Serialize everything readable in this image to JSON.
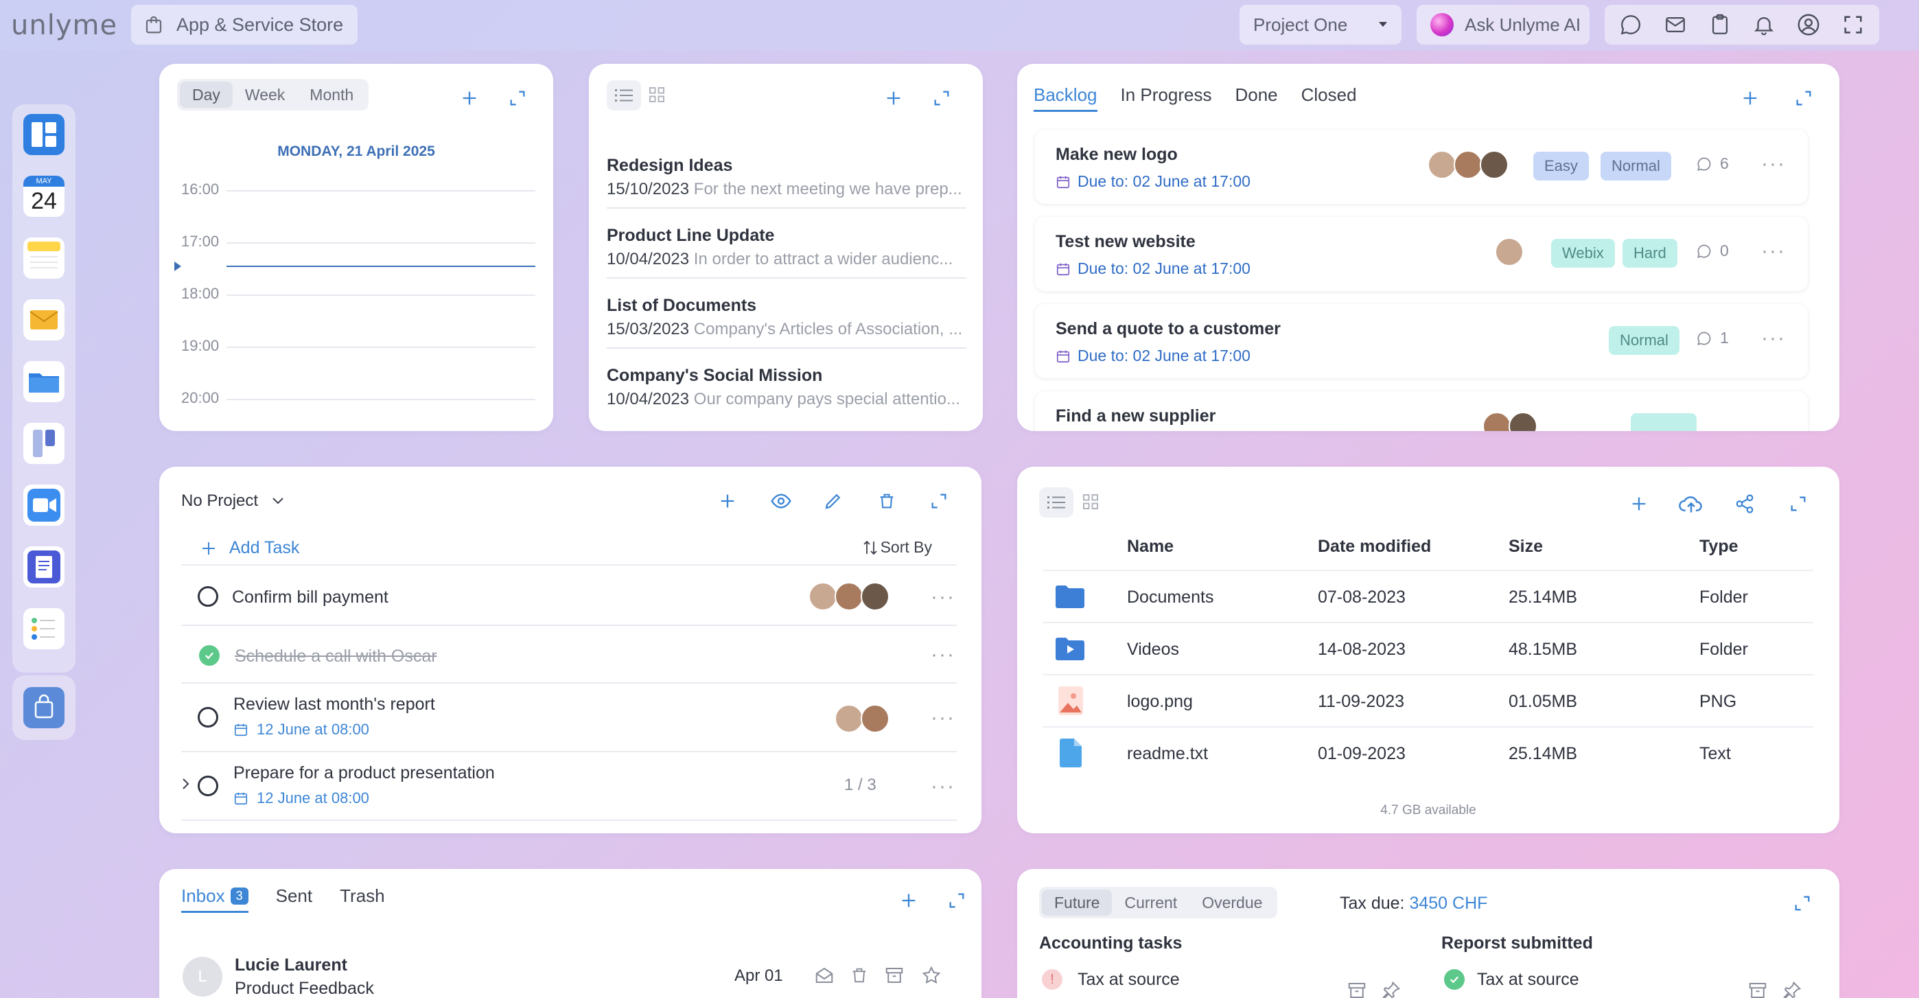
{
  "topbar": {
    "logo": "unlyme",
    "store_label": "App & Service Store",
    "project_selected": "Project One",
    "ai_label": "Ask Unlyme AI"
  },
  "dock": {
    "calendar_month": "MAY",
    "calendar_day": "24"
  },
  "calendar": {
    "views": [
      "Day",
      "Week",
      "Month"
    ],
    "active_view": "Day",
    "date_label": "MONDAY, 21 April 2025",
    "times": [
      "16:00",
      "17:00",
      "18:00",
      "19:00",
      "20:00"
    ]
  },
  "notes": {
    "items": [
      {
        "title": "Redesign Ideas",
        "date": "15/10/2023",
        "preview": "For the next meeting we have prep..."
      },
      {
        "title": "Product Line Update",
        "date": "10/04/2023",
        "preview": "In order to attract a wider audienc..."
      },
      {
        "title": "List of Documents",
        "date": "15/03/2023",
        "preview": "Company's Articles of Association, ..."
      },
      {
        "title": "Company's Social Mission",
        "date": "10/04/2023",
        "preview": "Our company pays special attentio..."
      }
    ]
  },
  "kanban": {
    "tabs": [
      "Backlog",
      "In Progress",
      "Done",
      "Closed"
    ],
    "cards": [
      {
        "title": "Make new logo",
        "due": "Due to: 02 June at 17:00",
        "tags": [
          "Easy",
          "Normal"
        ],
        "comments": "6"
      },
      {
        "title": "Test new website",
        "due": "Due to: 02 June at 17:00",
        "tags": [
          "Webix",
          "Hard"
        ],
        "comments": "0"
      },
      {
        "title": "Send a quote to a customer",
        "due": "Due to: 02 June at 17:00",
        "tags": [
          "Normal"
        ],
        "comments": "1"
      },
      {
        "title": "Find a new supplier"
      }
    ]
  },
  "tasks": {
    "project_filter": "No Project",
    "add_label": "Add Task",
    "sort_label": "Sort By",
    "items": [
      {
        "title": "Confirm bill payment"
      },
      {
        "title": "Schedule a call with Oscar",
        "done": true
      },
      {
        "title": "Review last month's report",
        "date": "12 June at 08:00"
      },
      {
        "title": "Prepare for a product presentation",
        "date": "12 June at 08:00",
        "progress": "1 / 3"
      }
    ]
  },
  "files": {
    "columns": [
      "Name",
      "Date modified",
      "Size",
      "Type"
    ],
    "rows": [
      {
        "name": "Documents",
        "date": "07-08-2023",
        "size": "25.14MB",
        "type": "Folder",
        "icon": "folder-icon"
      },
      {
        "name": "Videos",
        "date": "14-08-2023",
        "size": "48.15MB",
        "type": "Folder",
        "icon": "video-folder-icon"
      },
      {
        "name": "logo.png",
        "date": "11-09-2023",
        "size": "01.05MB",
        "type": "PNG",
        "icon": "image-file-icon"
      },
      {
        "name": "readme.txt",
        "date": "01-09-2023",
        "size": "25.14MB",
        "type": "Text",
        "icon": "text-file-icon"
      }
    ],
    "storage": "4.7 GB available"
  },
  "mail": {
    "tabs": [
      "Inbox",
      "Sent",
      "Trash"
    ],
    "inbox_count": "3",
    "messages": [
      {
        "avatar_letter": "L",
        "sender": "Lucie Laurent",
        "subject": "Product Feedback",
        "date": "Apr 01"
      }
    ]
  },
  "tax": {
    "tabs": [
      "Future",
      "Current",
      "Overdue"
    ],
    "tax_due_label": "Tax due:",
    "tax_due_value": "3450 CHF",
    "col1_title": "Accounting tasks",
    "col2_title": "Reporst submitted",
    "col1_items": [
      "Tax at source"
    ],
    "col2_items": [
      "Tax at source"
    ]
  },
  "colors": {
    "accent": "#3d86d6",
    "success": "#5cc88a",
    "warning": "#f3b2b2"
  }
}
